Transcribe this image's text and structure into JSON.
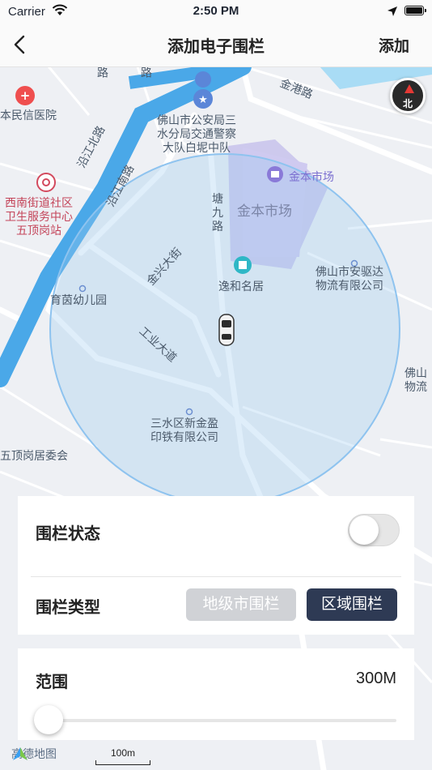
{
  "status_bar": {
    "carrier": "Carrier",
    "time": "2:50 PM"
  },
  "nav": {
    "title": "添加电子围栏",
    "action_label": "添加"
  },
  "map": {
    "labels": {
      "road_top1": "路",
      "road_top2": "路",
      "jingang": "金港路",
      "police": "佛山市公安局三\n水分局交通警察\n大队白坭中队",
      "hospital": "本民信医院",
      "clinic": "西南街道社区\n卫生服务中心\n五顶岗站",
      "yanjiang_n": "沿江北路",
      "yanjiang_s": "沿江南路",
      "jinben_poi": "金本市场",
      "jinben_area": "金本市场",
      "tangjiu": "塘九路",
      "jinxing": "金兴大街",
      "yihe": "逸和名居",
      "anqu": "佛山市安驱达\n物流有限公司",
      "yujun": "育茵幼儿园",
      "gongye": "工业大道",
      "foshan_r": "佛山\n物流",
      "xinjin": "三水区新金盈\n印铁有限公司",
      "wuding": "五顶岗居委会"
    },
    "compass_label": "北",
    "logo_text": "高德地图",
    "scale_label": "100m",
    "colors": {
      "fence": "#8ec3ef",
      "river": "#4aa8e8",
      "area": "#c9c4ec"
    }
  },
  "fence_panel": {
    "status_label": "围栏状态",
    "status_on": false,
    "type_label": "围栏类型",
    "type_options": [
      "地级市围栏",
      "区域围栏"
    ],
    "selected_type": "区域围栏"
  },
  "range_panel": {
    "label": "范围",
    "value": "300M",
    "slider_fraction": 0.0
  }
}
